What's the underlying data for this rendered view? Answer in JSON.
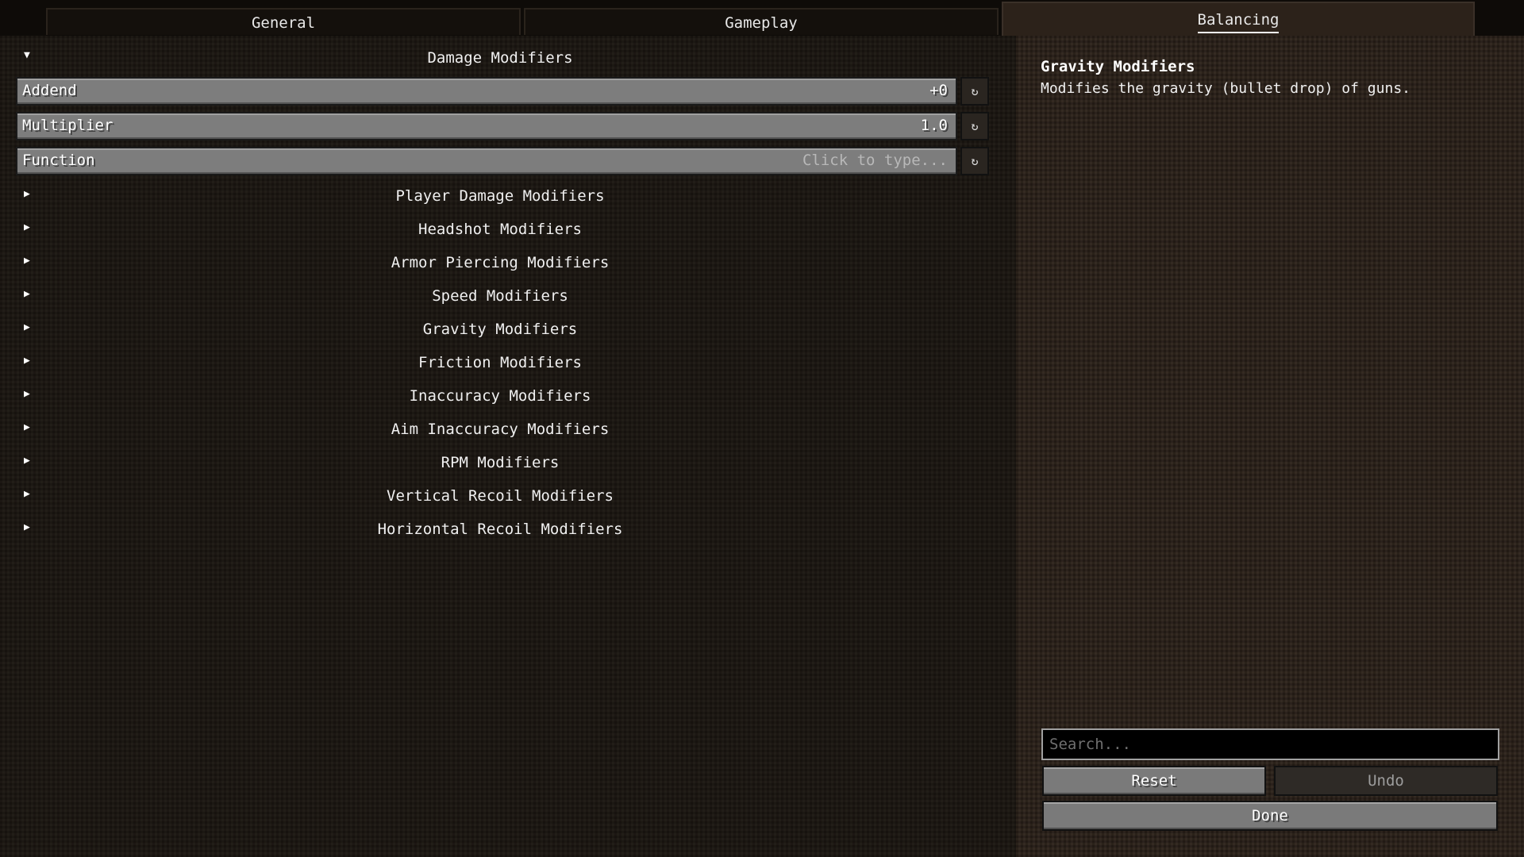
{
  "tabs": [
    {
      "label": "General",
      "active": false
    },
    {
      "label": "Gameplay",
      "active": false
    },
    {
      "label": "Balancing",
      "active": true
    }
  ],
  "section": {
    "title": "Damage Modifiers",
    "expanded": true,
    "fields": [
      {
        "label": "Addend",
        "value": "+0",
        "placeholder": ""
      },
      {
        "label": "Multiplier",
        "value": "1.0",
        "placeholder": ""
      },
      {
        "label": "Function",
        "value": "",
        "placeholder": "Click to type..."
      }
    ]
  },
  "collapsed_sections": [
    "Player Damage Modifiers",
    "Headshot Modifiers",
    "Armor Piercing Modifiers",
    "Speed Modifiers",
    "Gravity Modifiers",
    "Friction Modifiers",
    "Inaccuracy Modifiers",
    "Aim Inaccuracy Modifiers",
    "RPM Modifiers",
    "Vertical Recoil Modifiers",
    "Horizontal Recoil Modifiers"
  ],
  "description": {
    "title": "Gravity Modifiers",
    "text": "Modifies the gravity (bullet drop) of guns."
  },
  "search": {
    "placeholder": "Search...",
    "value": ""
  },
  "buttons": {
    "reset": "Reset",
    "undo": "Undo",
    "done": "Done"
  },
  "icons": {
    "expanded": "triangle-down-icon",
    "collapsed": "triangle-right-icon",
    "reset": "reset-arrow-icon"
  }
}
